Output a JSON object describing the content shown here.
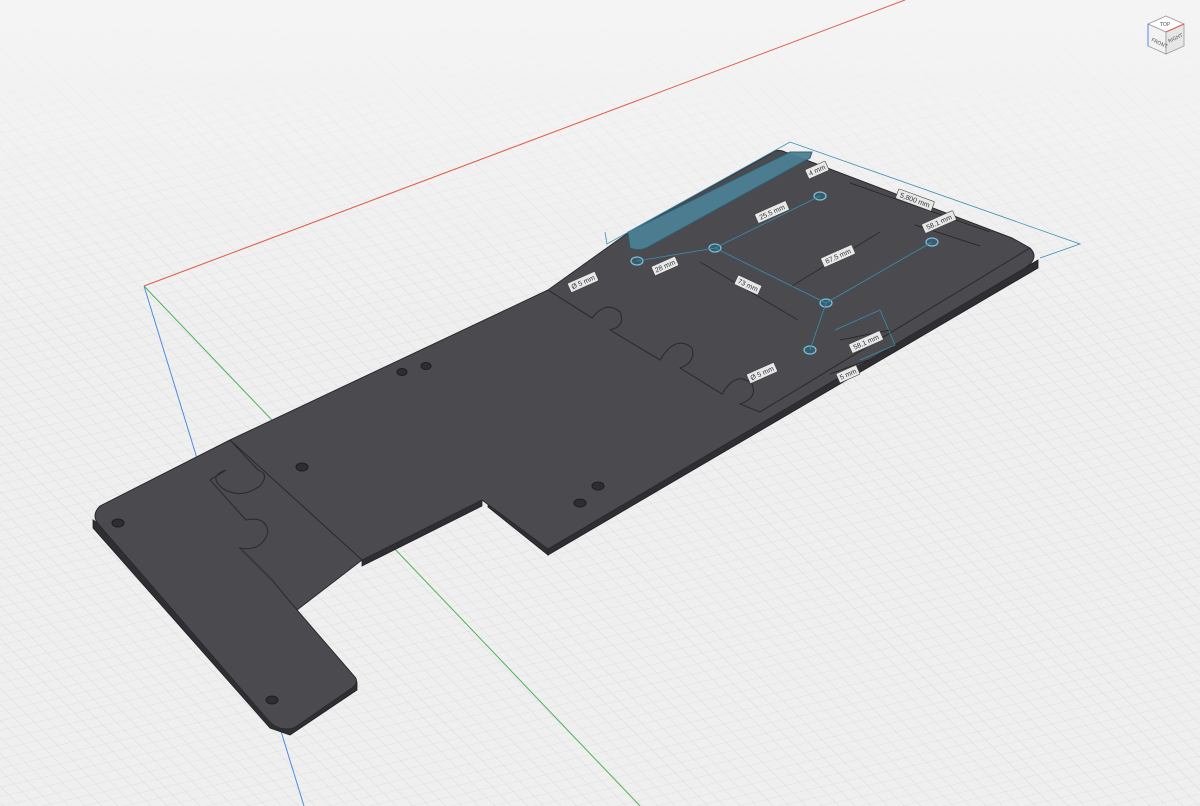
{
  "viewport": {
    "background": "#efefef",
    "grid_color": "#c9c9c9",
    "axis_colors": {
      "x": "#e05a4a",
      "y": "#4fb35a",
      "z": "#4a8de0"
    },
    "selection_color": "#3a8fb0"
  },
  "model": {
    "body_color": "#4a4a4f",
    "edge_color": "#2a2a2e"
  },
  "view_cube": {
    "faces": {
      "top": "TOP",
      "front": "FRONT",
      "right": "RIGHT"
    }
  },
  "dimensions": [
    {
      "name": "dim-top-width",
      "text": "4 mm"
    },
    {
      "name": "dim-overall-length",
      "text": "5,800 mm"
    },
    {
      "name": "dim-hole-spacing-top",
      "text": "25.5 mm"
    },
    {
      "name": "dim-hole-diameter-left",
      "text": "Ø 5 mm"
    },
    {
      "name": "dim-offset-left",
      "text": "28 mm"
    },
    {
      "name": "dim-vertical-87",
      "text": "87.5 mm"
    },
    {
      "name": "dim-right-edge-top",
      "text": "58.1 mm"
    },
    {
      "name": "dim-center-73",
      "text": "73 mm"
    },
    {
      "name": "dim-right-edge-bottom",
      "text": "58.1 mm"
    },
    {
      "name": "dim-hole-diameter-bottom",
      "text": "Ø 5 mm"
    },
    {
      "name": "dim-bottom-gap",
      "text": "5 mm"
    }
  ]
}
